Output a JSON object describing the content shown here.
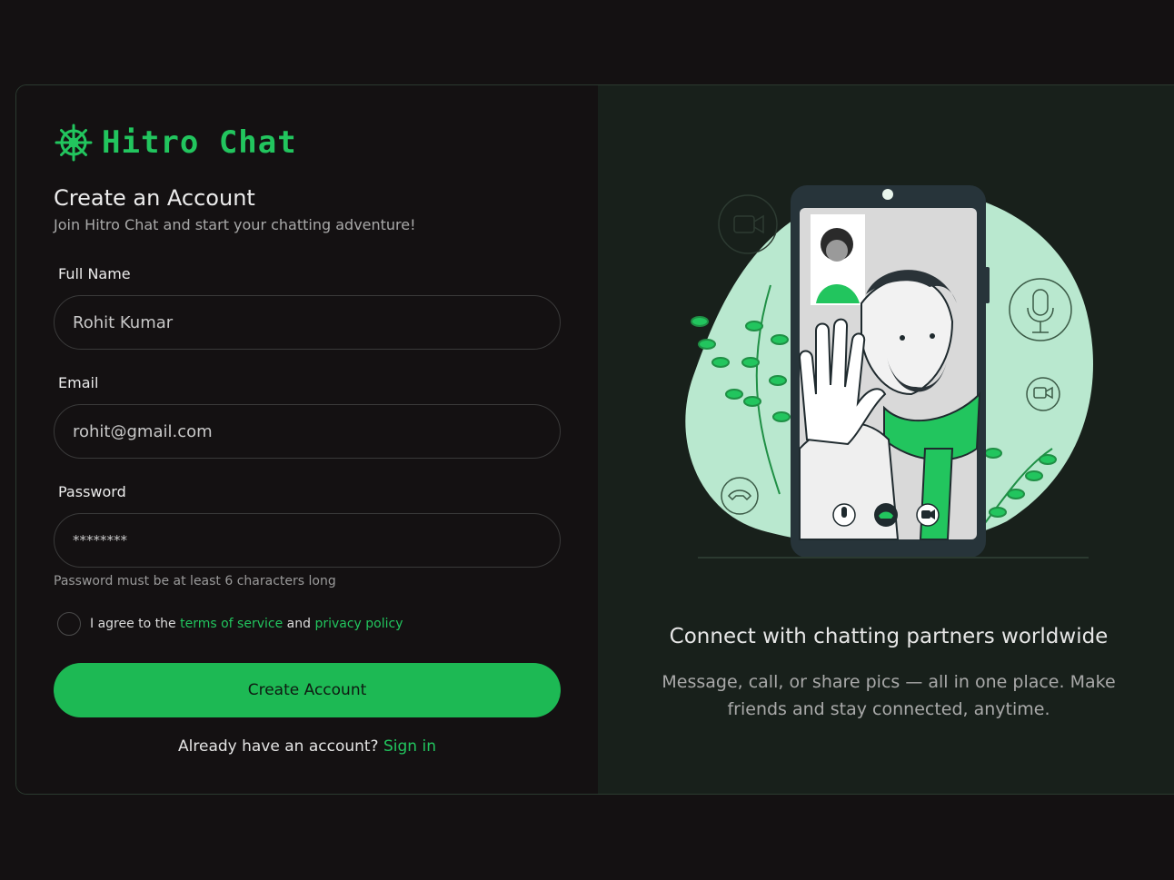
{
  "brand": {
    "name": "Hitro Chat",
    "icon": "dharma-wheel-icon"
  },
  "form": {
    "title": "Create an Account",
    "subtitle": "Join Hitro Chat and start your chatting adventure!",
    "full_name": {
      "label": "Full Name",
      "value": "Rohit Kumar"
    },
    "email": {
      "label": "Email",
      "value": "rohit@gmail.com"
    },
    "password": {
      "label": "Password",
      "value": "********"
    },
    "password_hint": "Password must be at least 6 characters long",
    "agree": {
      "prefix": "I agree to the",
      "terms": "terms of service",
      "and": "and",
      "privacy": "privacy policy"
    },
    "submit_label": "Create Account",
    "signin_prompt": "Already have an account?",
    "signin_link": "Sign in"
  },
  "promo": {
    "title": "Connect with chatting partners worldwide",
    "description": "Message, call, or share pics — all in one place. Make friends and stay connected, anytime."
  },
  "colors": {
    "accent": "#22c55e",
    "button": "#1db954",
    "background": "#141112",
    "panel": "#18201b"
  }
}
